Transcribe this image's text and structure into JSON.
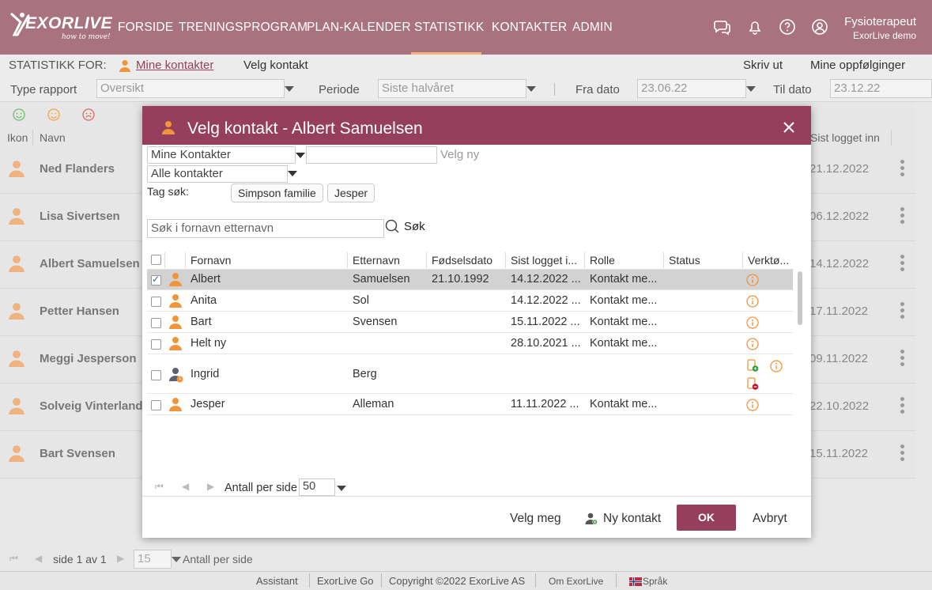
{
  "nav": {
    "logo_text": "EXORLIVE",
    "logo_tag": "how to move!",
    "items": [
      "FORSIDE",
      "TRENINGSPROGRAM",
      "PLAN-KALENDER",
      "STATISTIKK",
      "KONTAKTER",
      "ADMIN"
    ],
    "active": "STATISTIKK",
    "user_role": "Fysioterapeut",
    "user_org": "ExorLive demo",
    "icons": [
      "chat-icon",
      "bell-icon",
      "help-icon",
      "user-icon"
    ]
  },
  "filter": {
    "stats_for_label": "STATISTIKK FOR:",
    "my_contacts_link": "Mine kontakter",
    "choose_contact": "Velg kontakt",
    "print": "Skriv ut",
    "followups": "Mine oppfølginger",
    "report_type_label": "Type rapport",
    "report_type_value": "Oversikt",
    "period_label": "Periode",
    "period_value": "Siste halvåret",
    "from_label": "Fra dato",
    "from_value": "23.06.22",
    "to_label": "Til dato",
    "to_value": "23.12.22"
  },
  "list": {
    "col_icon": "Ikon",
    "col_name": "Navn",
    "col_last_login": "Sist logget inn",
    "rows": [
      {
        "name": "Ned Flanders",
        "date": "21.12.2022"
      },
      {
        "name": "Lisa Sivertsen",
        "date": "06.12.2022"
      },
      {
        "name": "Albert Samuelsen",
        "date": "14.12.2022"
      },
      {
        "name": "Petter Hansen",
        "date": "17.11.2022"
      },
      {
        "name": "Meggi Jesperson",
        "date": "09.11.2022"
      },
      {
        "name": "Solveig Vinterland",
        "date": "22.10.2022"
      },
      {
        "name": "Bart Svensen",
        "date": "15.11.2022"
      }
    ]
  },
  "pager": {
    "page_text": "side 1 av 1",
    "per_page_value": "15",
    "per_page_label": "Antall per side"
  },
  "footer": {
    "links": [
      "Assistant",
      "ExorLive Go",
      "Copyright ©2022 ExorLive AS",
      "Om ExorLive",
      "Språk"
    ]
  },
  "modal": {
    "title": "Velg kontakt - Albert Samuelsen",
    "contacts_select": "Mine Kontakter",
    "choose_new": "Velg ny",
    "all_contacts_select": "Alle kontakter",
    "tag_search_label": "Tag søk:",
    "tags": [
      "Simpson familie",
      "Jesper"
    ],
    "search_placeholder": "Søk i fornavn etternavn",
    "search_button": "Søk",
    "columns": [
      "Fornavn",
      "Etternavn",
      "Fødselsdato",
      "Sist logget i...",
      "Rolle",
      "Status",
      "Verktø..."
    ],
    "rows": [
      {
        "first": "Albert",
        "last": "Samuelsen",
        "dob": "21.10.1992",
        "last_login": "14.12.2022 ...",
        "role": "Kontakt me...",
        "status": "",
        "checked": true,
        "selected": true,
        "avatar": "orange"
      },
      {
        "first": "Anita",
        "last": "Sol",
        "dob": "",
        "last_login": "14.12.2022 ...",
        "role": "Kontakt me...",
        "status": "",
        "checked": false,
        "selected": false,
        "avatar": "orange"
      },
      {
        "first": "Bart",
        "last": "Svensen",
        "dob": "",
        "last_login": "15.11.2022 ...",
        "role": "Kontakt me...",
        "status": "",
        "checked": false,
        "selected": false,
        "avatar": "orange"
      },
      {
        "first": "Helt ny",
        "last": "",
        "dob": "",
        "last_login": "28.10.2021 ...",
        "role": "Kontakt me...",
        "status": "",
        "checked": false,
        "selected": false,
        "avatar": "orange"
      },
      {
        "first": "Ingrid",
        "last": "Berg",
        "dob": "",
        "last_login": "",
        "role": "",
        "status": "",
        "checked": false,
        "selected": false,
        "avatar": "gray"
      },
      {
        "first": "Jesper",
        "last": "Alleman",
        "dob": "",
        "last_login": "11.11.2022 ...",
        "role": "Kontakt me...",
        "status": "",
        "checked": false,
        "selected": false,
        "avatar": "orange"
      }
    ],
    "per_page_label": "Antall per side",
    "per_page_value": "50",
    "choose_me": "Velg meg",
    "new_contact": "Ny kontakt",
    "ok": "OK",
    "cancel": "Avbryt"
  },
  "colors": {
    "nav_bg": "#a8727f",
    "modal_header": "#953f5c",
    "accent_orange": "#f0953a",
    "active_underline": "#f2b27b"
  }
}
